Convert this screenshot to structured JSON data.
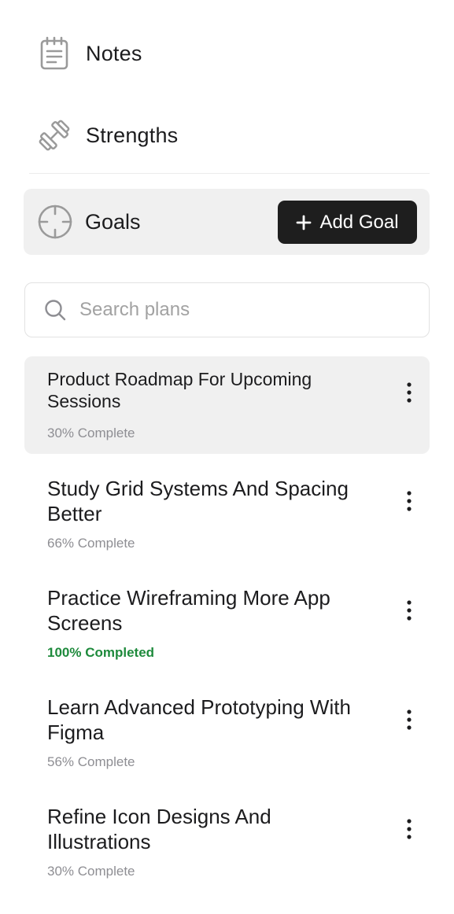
{
  "nav": {
    "notes": {
      "label": "Notes",
      "icon": "notepad-icon"
    },
    "strengths": {
      "label": "Strengths",
      "icon": "dumbbell-icon"
    },
    "goals": {
      "label": "Goals",
      "icon": "crosshair-icon"
    }
  },
  "goals": {
    "add_label": "Add Goal"
  },
  "search": {
    "placeholder": "Search plans",
    "value": ""
  },
  "plans": [
    {
      "title": "Product Roadmap For Upcoming Sessions",
      "status": "30% Complete",
      "progress": 30,
      "active": true
    },
    {
      "title": "Study Grid Systems And Spacing Better",
      "status": "66% Complete",
      "progress": 66,
      "active": false
    },
    {
      "title": "Practice Wireframing More App Screens",
      "status": "100% Completed",
      "progress": 100,
      "active": false
    },
    {
      "title": "Learn Advanced Prototyping With Figma",
      "status": "56% Complete",
      "progress": 56,
      "active": false
    },
    {
      "title": "Refine Icon Designs And Illustrations",
      "status": "30% Complete",
      "progress": 30,
      "active": false
    }
  ],
  "colors": {
    "accent_dark": "#1e1e1e",
    "active_bg": "#f0f0f0",
    "completed": "#1e8a3c",
    "muted": "#8e8e93"
  }
}
